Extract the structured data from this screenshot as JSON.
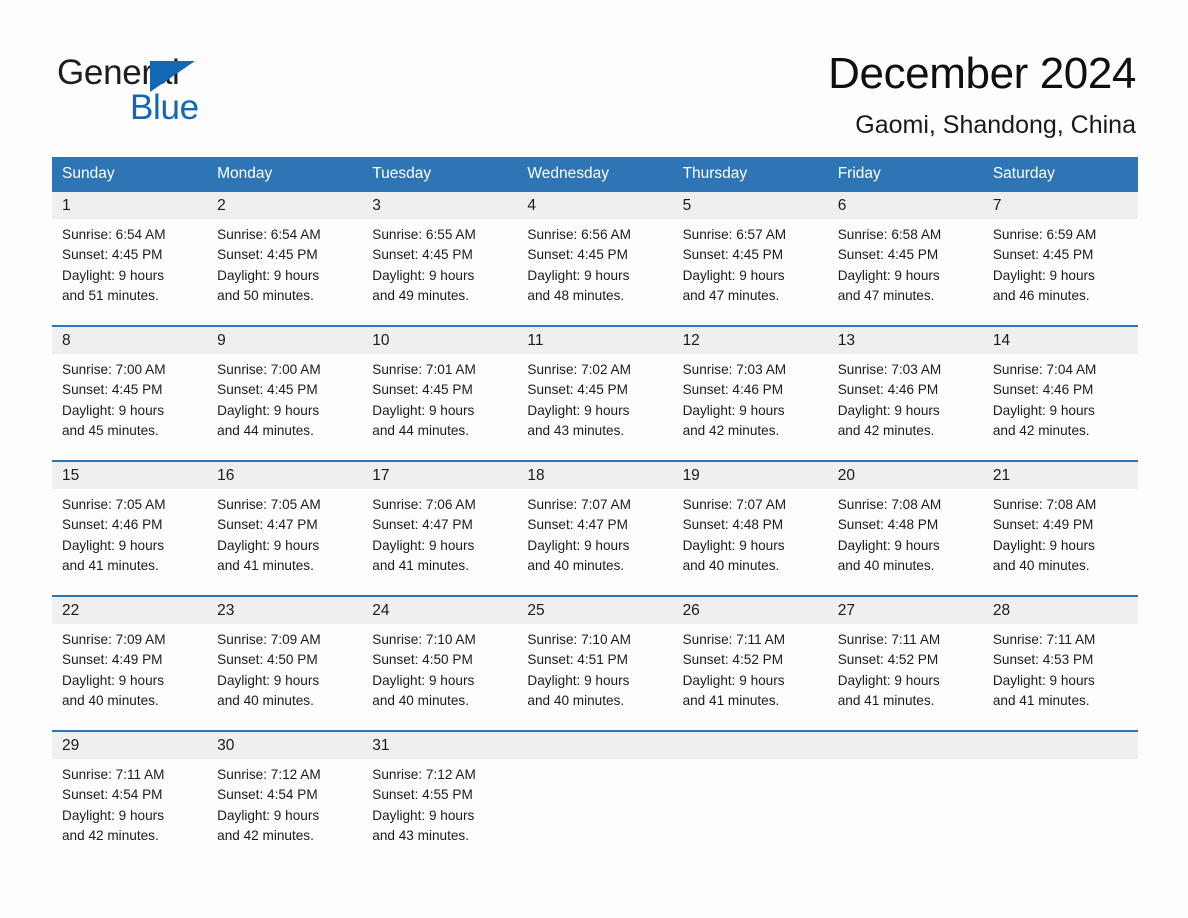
{
  "brand": {
    "name_part1": "General",
    "name_part2": "Blue",
    "flag_icon": "triangle-flag-icon",
    "accent_color": "#1268b3"
  },
  "header": {
    "month_title": "December 2024",
    "location": "Gaomi, Shandong, China"
  },
  "theme": {
    "header_blue": "#2e75b6",
    "row_band_gray": "#efefef",
    "page_background": "#fdfdfd",
    "text_color": "#1b1b1b"
  },
  "weekdays": [
    "Sunday",
    "Monday",
    "Tuesday",
    "Wednesday",
    "Thursday",
    "Friday",
    "Saturday"
  ],
  "weeks": [
    {
      "days": [
        {
          "day": "1",
          "sunrise": "Sunrise: 6:54 AM",
          "sunset": "Sunset: 4:45 PM",
          "daylight_line1": "Daylight: 9 hours",
          "daylight_line2": "and 51 minutes."
        },
        {
          "day": "2",
          "sunrise": "Sunrise: 6:54 AM",
          "sunset": "Sunset: 4:45 PM",
          "daylight_line1": "Daylight: 9 hours",
          "daylight_line2": "and 50 minutes."
        },
        {
          "day": "3",
          "sunrise": "Sunrise: 6:55 AM",
          "sunset": "Sunset: 4:45 PM",
          "daylight_line1": "Daylight: 9 hours",
          "daylight_line2": "and 49 minutes."
        },
        {
          "day": "4",
          "sunrise": "Sunrise: 6:56 AM",
          "sunset": "Sunset: 4:45 PM",
          "daylight_line1": "Daylight: 9 hours",
          "daylight_line2": "and 48 minutes."
        },
        {
          "day": "5",
          "sunrise": "Sunrise: 6:57 AM",
          "sunset": "Sunset: 4:45 PM",
          "daylight_line1": "Daylight: 9 hours",
          "daylight_line2": "and 47 minutes."
        },
        {
          "day": "6",
          "sunrise": "Sunrise: 6:58 AM",
          "sunset": "Sunset: 4:45 PM",
          "daylight_line1": "Daylight: 9 hours",
          "daylight_line2": "and 47 minutes."
        },
        {
          "day": "7",
          "sunrise": "Sunrise: 6:59 AM",
          "sunset": "Sunset: 4:45 PM",
          "daylight_line1": "Daylight: 9 hours",
          "daylight_line2": "and 46 minutes."
        }
      ]
    },
    {
      "days": [
        {
          "day": "8",
          "sunrise": "Sunrise: 7:00 AM",
          "sunset": "Sunset: 4:45 PM",
          "daylight_line1": "Daylight: 9 hours",
          "daylight_line2": "and 45 minutes."
        },
        {
          "day": "9",
          "sunrise": "Sunrise: 7:00 AM",
          "sunset": "Sunset: 4:45 PM",
          "daylight_line1": "Daylight: 9 hours",
          "daylight_line2": "and 44 minutes."
        },
        {
          "day": "10",
          "sunrise": "Sunrise: 7:01 AM",
          "sunset": "Sunset: 4:45 PM",
          "daylight_line1": "Daylight: 9 hours",
          "daylight_line2": "and 44 minutes."
        },
        {
          "day": "11",
          "sunrise": "Sunrise: 7:02 AM",
          "sunset": "Sunset: 4:45 PM",
          "daylight_line1": "Daylight: 9 hours",
          "daylight_line2": "and 43 minutes."
        },
        {
          "day": "12",
          "sunrise": "Sunrise: 7:03 AM",
          "sunset": "Sunset: 4:46 PM",
          "daylight_line1": "Daylight: 9 hours",
          "daylight_line2": "and 42 minutes."
        },
        {
          "day": "13",
          "sunrise": "Sunrise: 7:03 AM",
          "sunset": "Sunset: 4:46 PM",
          "daylight_line1": "Daylight: 9 hours",
          "daylight_line2": "and 42 minutes."
        },
        {
          "day": "14",
          "sunrise": "Sunrise: 7:04 AM",
          "sunset": "Sunset: 4:46 PM",
          "daylight_line1": "Daylight: 9 hours",
          "daylight_line2": "and 42 minutes."
        }
      ]
    },
    {
      "days": [
        {
          "day": "15",
          "sunrise": "Sunrise: 7:05 AM",
          "sunset": "Sunset: 4:46 PM",
          "daylight_line1": "Daylight: 9 hours",
          "daylight_line2": "and 41 minutes."
        },
        {
          "day": "16",
          "sunrise": "Sunrise: 7:05 AM",
          "sunset": "Sunset: 4:47 PM",
          "daylight_line1": "Daylight: 9 hours",
          "daylight_line2": "and 41 minutes."
        },
        {
          "day": "17",
          "sunrise": "Sunrise: 7:06 AM",
          "sunset": "Sunset: 4:47 PM",
          "daylight_line1": "Daylight: 9 hours",
          "daylight_line2": "and 41 minutes."
        },
        {
          "day": "18",
          "sunrise": "Sunrise: 7:07 AM",
          "sunset": "Sunset: 4:47 PM",
          "daylight_line1": "Daylight: 9 hours",
          "daylight_line2": "and 40 minutes."
        },
        {
          "day": "19",
          "sunrise": "Sunrise: 7:07 AM",
          "sunset": "Sunset: 4:48 PM",
          "daylight_line1": "Daylight: 9 hours",
          "daylight_line2": "and 40 minutes."
        },
        {
          "day": "20",
          "sunrise": "Sunrise: 7:08 AM",
          "sunset": "Sunset: 4:48 PM",
          "daylight_line1": "Daylight: 9 hours",
          "daylight_line2": "and 40 minutes."
        },
        {
          "day": "21",
          "sunrise": "Sunrise: 7:08 AM",
          "sunset": "Sunset: 4:49 PM",
          "daylight_line1": "Daylight: 9 hours",
          "daylight_line2": "and 40 minutes."
        }
      ]
    },
    {
      "days": [
        {
          "day": "22",
          "sunrise": "Sunrise: 7:09 AM",
          "sunset": "Sunset: 4:49 PM",
          "daylight_line1": "Daylight: 9 hours",
          "daylight_line2": "and 40 minutes."
        },
        {
          "day": "23",
          "sunrise": "Sunrise: 7:09 AM",
          "sunset": "Sunset: 4:50 PM",
          "daylight_line1": "Daylight: 9 hours",
          "daylight_line2": "and 40 minutes."
        },
        {
          "day": "24",
          "sunrise": "Sunrise: 7:10 AM",
          "sunset": "Sunset: 4:50 PM",
          "daylight_line1": "Daylight: 9 hours",
          "daylight_line2": "and 40 minutes."
        },
        {
          "day": "25",
          "sunrise": "Sunrise: 7:10 AM",
          "sunset": "Sunset: 4:51 PM",
          "daylight_line1": "Daylight: 9 hours",
          "daylight_line2": "and 40 minutes."
        },
        {
          "day": "26",
          "sunrise": "Sunrise: 7:11 AM",
          "sunset": "Sunset: 4:52 PM",
          "daylight_line1": "Daylight: 9 hours",
          "daylight_line2": "and 41 minutes."
        },
        {
          "day": "27",
          "sunrise": "Sunrise: 7:11 AM",
          "sunset": "Sunset: 4:52 PM",
          "daylight_line1": "Daylight: 9 hours",
          "daylight_line2": "and 41 minutes."
        },
        {
          "day": "28",
          "sunrise": "Sunrise: 7:11 AM",
          "sunset": "Sunset: 4:53 PM",
          "daylight_line1": "Daylight: 9 hours",
          "daylight_line2": "and 41 minutes."
        }
      ]
    },
    {
      "days": [
        {
          "day": "29",
          "sunrise": "Sunrise: 7:11 AM",
          "sunset": "Sunset: 4:54 PM",
          "daylight_line1": "Daylight: 9 hours",
          "daylight_line2": "and 42 minutes."
        },
        {
          "day": "30",
          "sunrise": "Sunrise: 7:12 AM",
          "sunset": "Sunset: 4:54 PM",
          "daylight_line1": "Daylight: 9 hours",
          "daylight_line2": "and 42 minutes."
        },
        {
          "day": "31",
          "sunrise": "Sunrise: 7:12 AM",
          "sunset": "Sunset: 4:55 PM",
          "daylight_line1": "Daylight: 9 hours",
          "daylight_line2": "and 43 minutes."
        },
        {
          "day": "",
          "sunrise": "",
          "sunset": "",
          "daylight_line1": "",
          "daylight_line2": ""
        },
        {
          "day": "",
          "sunrise": "",
          "sunset": "",
          "daylight_line1": "",
          "daylight_line2": ""
        },
        {
          "day": "",
          "sunrise": "",
          "sunset": "",
          "daylight_line1": "",
          "daylight_line2": ""
        },
        {
          "day": "",
          "sunrise": "",
          "sunset": "",
          "daylight_line1": "",
          "daylight_line2": ""
        }
      ]
    }
  ]
}
